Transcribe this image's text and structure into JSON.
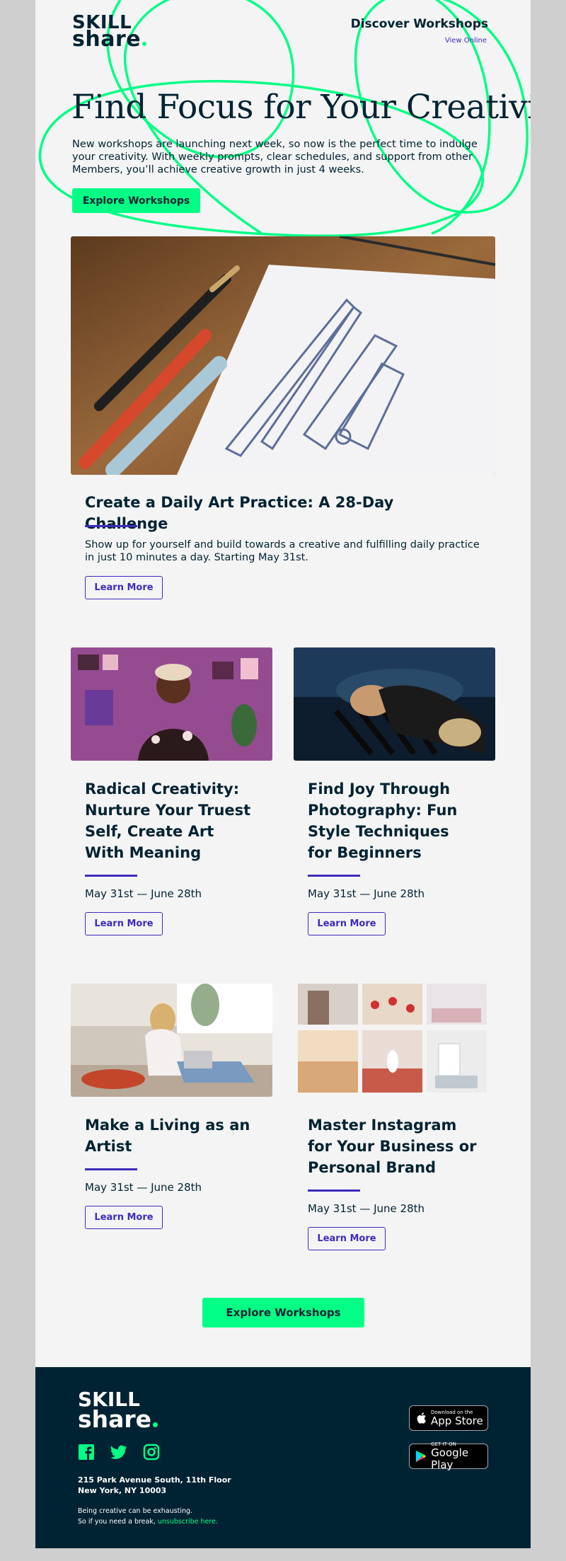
{
  "brand": {
    "logo_line1": "SKILL",
    "logo_line2": "share",
    "accent_color": "#00ff84",
    "link_color": "#3d2bbd",
    "dark_color": "#002333"
  },
  "header": {
    "discover": "Discover Workshops",
    "view_online": "View Online"
  },
  "hero": {
    "title": "Find Focus for Your Creativity",
    "text": "New workshops are launching next week, so now is the perfect time to indulge your creativity. With weekly prompts, clear schedules, and support from other Members, you’ll achieve creative growth in just 4 weeks.",
    "button": "Explore Workshops"
  },
  "feature": {
    "title": "Create a Daily Art Practice: A 28-Day Challenge",
    "text": "Show up for yourself and build towards a creative and fulfilling daily practice in just 10 minutes a day. Starting May 31st.",
    "button": "Learn More"
  },
  "workshops": [
    {
      "title": "Radical Creativity: Nurture Your Truest Self, Create Art With Meaning",
      "dates": "May 31st — June 28th",
      "button": "Learn More"
    },
    {
      "title": "Find Joy Through Photography: Fun Style Techniques for Beginners",
      "dates": "May 31st — June 28th",
      "button": "Learn More"
    },
    {
      "title": "Make a Living as an Artist",
      "dates": "May 31st — June 28th",
      "button": "Learn More"
    },
    {
      "title": "Master Instagram for Your Business or Personal Brand",
      "dates": "May 31st — June 28th",
      "button": "Learn More"
    }
  ],
  "bottom_button": "Explore Workshops",
  "footer": {
    "logo_line1": "SKILL",
    "logo_line2": "share",
    "social": [
      "facebook-icon",
      "twitter-icon",
      "instagram-icon"
    ],
    "address_line1": "215 Park Avenue South, 11th Floor",
    "address_line2": "New York, NY 10003",
    "note_line1": "Being creative can be exhausting.",
    "note_line2": "So if you need a break,",
    "unsubscribe": "unsubscribe here.",
    "app_store_small": "Download on the",
    "app_store_big": "App Store",
    "google_play_small": "GET IT ON",
    "google_play_big": "Google Play"
  }
}
